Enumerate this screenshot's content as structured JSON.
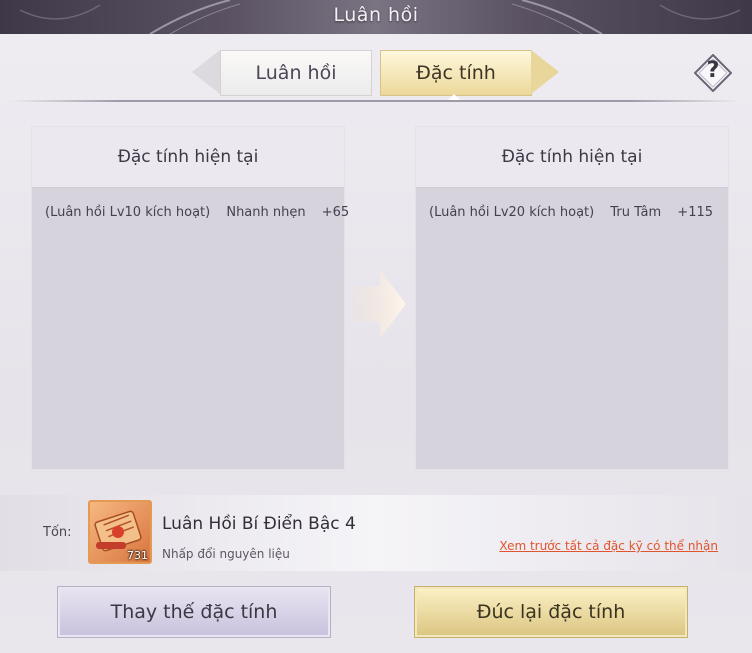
{
  "window": {
    "title": "Luân hồi"
  },
  "tabs": [
    {
      "label": "Luân hồi",
      "active": false
    },
    {
      "label": "Đặc tính",
      "active": true
    }
  ],
  "help": {
    "icon": "question-icon",
    "label": "?"
  },
  "panels": {
    "left": {
      "title": "Đặc tính hiện tại",
      "source": "(Luân hồi Lv10 kích hoạt)",
      "stat": "Nhanh nhẹn",
      "value": "+65"
    },
    "right": {
      "title": "Đặc tính hiện tại",
      "source": "(Luân hồi Lv20 kích hoạt)",
      "stat": "Tru Tâm",
      "value": "+115"
    }
  },
  "center_arrow": {
    "icon": "arrow-right-icon"
  },
  "cost": {
    "label": "Tốn:",
    "item_name": "Luân Hồi Bí Điển Bậc 4",
    "item_count": "731",
    "item_hint": "Nhấp đổi nguyên liệu",
    "item_icon": "scroll-icon",
    "preview_link": "Xem trước tất cả đặc kỹ có thể nhận"
  },
  "buttons": {
    "replace": "Thay thế đặc tính",
    "recast": "Đúc lại đặc tính"
  },
  "colors": {
    "accent_gold": "#ecd89a",
    "link": "#e0552e",
    "banner": "#5a5262"
  }
}
